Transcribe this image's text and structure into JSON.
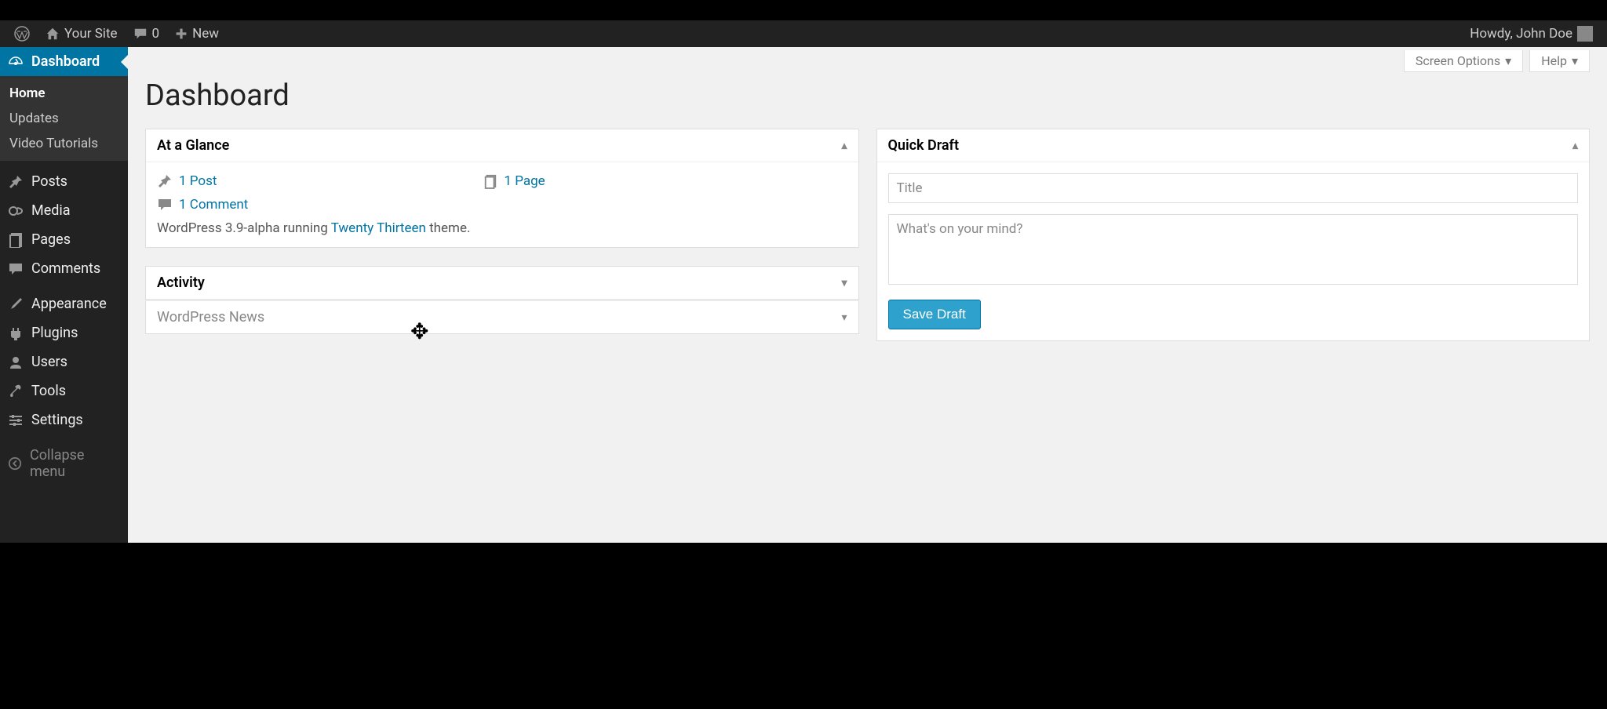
{
  "adminbar": {
    "site_name": "Your Site",
    "comments_count": "0",
    "new_label": "New",
    "howdy": "Howdy, John Doe"
  },
  "screen_meta": {
    "screen_options": "Screen Options",
    "help": "Help"
  },
  "page": {
    "title": "Dashboard"
  },
  "sidebar": {
    "dashboard": "Dashboard",
    "submenu": {
      "home": "Home",
      "updates": "Updates",
      "video_tutorials": "Video Tutorials"
    },
    "posts": "Posts",
    "media": "Media",
    "pages": "Pages",
    "comments": "Comments",
    "appearance": "Appearance",
    "plugins": "Plugins",
    "users": "Users",
    "tools": "Tools",
    "settings": "Settings",
    "collapse": "Collapse menu"
  },
  "glance": {
    "title": "At a Glance",
    "posts": "1 Post",
    "pages": "1 Page",
    "comments": "1 Comment",
    "version_prefix": "WordPress 3.9-alpha running ",
    "theme": "Twenty Thirteen",
    "version_suffix": " theme."
  },
  "activity": {
    "title": "Activity"
  },
  "wpnews": {
    "title": "WordPress News"
  },
  "quickdraft": {
    "title": "Quick Draft",
    "title_placeholder": "Title",
    "content_placeholder": "What's on your mind?",
    "save_label": "Save Draft"
  }
}
